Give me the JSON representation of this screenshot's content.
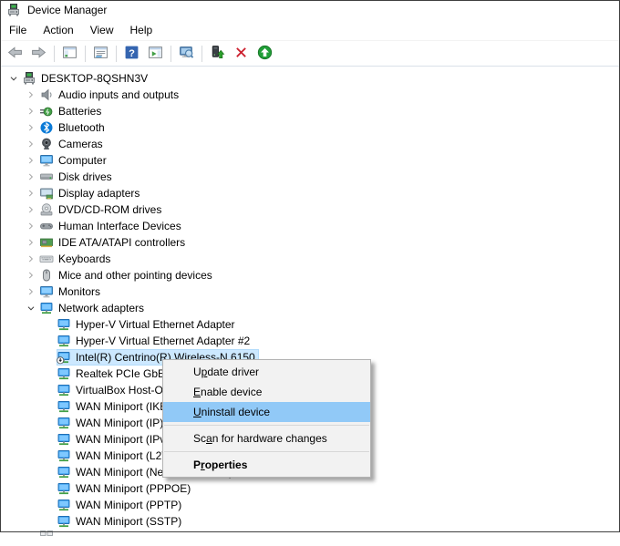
{
  "window": {
    "title": "Device Manager",
    "app_icon": "device-manager-icon"
  },
  "menu_bar": {
    "items": [
      {
        "label": "File"
      },
      {
        "label": "Action"
      },
      {
        "label": "View"
      },
      {
        "label": "Help"
      }
    ]
  },
  "toolbar": {
    "buttons": [
      {
        "name": "back-button",
        "icon": "back-icon"
      },
      {
        "name": "forward-button",
        "icon": "forward-icon"
      },
      {
        "separator": true
      },
      {
        "name": "console-tree-button",
        "icon": "console-tree-icon"
      },
      {
        "separator": true
      },
      {
        "name": "properties-button",
        "icon": "properties-icon"
      },
      {
        "separator": true
      },
      {
        "name": "help-button",
        "icon": "help-icon"
      },
      {
        "name": "action-pane-button",
        "icon": "action-pane-icon"
      },
      {
        "separator": true
      },
      {
        "name": "scan-hardware-button",
        "icon": "scan-hardware-icon"
      },
      {
        "separator": true
      },
      {
        "name": "enable-device-button",
        "icon": "enable-device-icon"
      },
      {
        "name": "uninstall-device-button",
        "icon": "uninstall-device-icon"
      },
      {
        "name": "update-driver-button",
        "icon": "update-driver-icon"
      }
    ]
  },
  "tree": {
    "items": [
      {
        "level": 0,
        "chevron": "expanded",
        "icon": "computer-host-icon",
        "label": "DESKTOP-8QSHN3V"
      },
      {
        "level": 1,
        "chevron": "collapsed",
        "icon": "audio-icon",
        "label": "Audio inputs and outputs"
      },
      {
        "level": 1,
        "chevron": "collapsed",
        "icon": "battery-icon",
        "label": "Batteries"
      },
      {
        "level": 1,
        "chevron": "collapsed",
        "icon": "bluetooth-icon",
        "label": "Bluetooth"
      },
      {
        "level": 1,
        "chevron": "collapsed",
        "icon": "camera-icon",
        "label": "Cameras"
      },
      {
        "level": 1,
        "chevron": "collapsed",
        "icon": "monitor-icon",
        "label": "Computer"
      },
      {
        "level": 1,
        "chevron": "collapsed",
        "icon": "disk-icon",
        "label": "Disk drives"
      },
      {
        "level": 1,
        "chevron": "collapsed",
        "icon": "display-icon",
        "label": "Display adapters"
      },
      {
        "level": 1,
        "chevron": "collapsed",
        "icon": "dvd-icon",
        "label": "DVD/CD-ROM drives"
      },
      {
        "level": 1,
        "chevron": "collapsed",
        "icon": "hid-icon",
        "label": "Human Interface Devices"
      },
      {
        "level": 1,
        "chevron": "collapsed",
        "icon": "ide-icon",
        "label": "IDE ATA/ATAPI controllers"
      },
      {
        "level": 1,
        "chevron": "collapsed",
        "icon": "keyboard-icon",
        "label": "Keyboards"
      },
      {
        "level": 1,
        "chevron": "collapsed",
        "icon": "mouse-icon",
        "label": "Mice and other pointing devices"
      },
      {
        "level": 1,
        "chevron": "collapsed",
        "icon": "monitor-icon",
        "label": "Monitors"
      },
      {
        "level": 1,
        "chevron": "expanded",
        "icon": "network-icon",
        "label": "Network adapters"
      },
      {
        "level": 2,
        "chevron": "none",
        "icon": "network-icon",
        "label": "Hyper-V Virtual Ethernet Adapter"
      },
      {
        "level": 2,
        "chevron": "none",
        "icon": "network-icon",
        "label": "Hyper-V Virtual Ethernet Adapter #2"
      },
      {
        "level": 2,
        "chevron": "none",
        "icon": "network-disabled-icon",
        "label": "Intel(R) Centrino(R) Wireless-N 6150",
        "selected": true
      },
      {
        "level": 2,
        "chevron": "none",
        "icon": "network-icon",
        "label": "Realtek PCIe GbE Family Controller"
      },
      {
        "level": 2,
        "chevron": "none",
        "icon": "network-icon",
        "label": "VirtualBox Host-Only Ethernet Adapter"
      },
      {
        "level": 2,
        "chevron": "none",
        "icon": "network-icon",
        "label": "WAN Miniport (IKEv2)"
      },
      {
        "level": 2,
        "chevron": "none",
        "icon": "network-icon",
        "label": "WAN Miniport (IP)"
      },
      {
        "level": 2,
        "chevron": "none",
        "icon": "network-icon",
        "label": "WAN Miniport (IPv6)"
      },
      {
        "level": 2,
        "chevron": "none",
        "icon": "network-icon",
        "label": "WAN Miniport (L2TP)"
      },
      {
        "level": 2,
        "chevron": "none",
        "icon": "network-icon",
        "label": "WAN Miniport (Network Monitor)"
      },
      {
        "level": 2,
        "chevron": "none",
        "icon": "network-icon",
        "label": "WAN Miniport (PPPOE)"
      },
      {
        "level": 2,
        "chevron": "none",
        "icon": "network-icon",
        "label": "WAN Miniport (PPTP)"
      },
      {
        "level": 2,
        "chevron": "none",
        "icon": "network-icon",
        "label": "WAN Miniport (SSTP)"
      },
      {
        "level": 1,
        "chevron": "none",
        "icon": "partial-icon",
        "label": ""
      }
    ]
  },
  "context_menu": {
    "items": [
      {
        "label": "Update driver",
        "accel_index": 1
      },
      {
        "label": "Enable device",
        "accel_index": 0
      },
      {
        "label": "Uninstall device",
        "accel_index": 0,
        "highlighted": true
      },
      {
        "separator": true
      },
      {
        "label": "Scan for hardware changes",
        "accel_index": 2
      },
      {
        "separator": true
      },
      {
        "label": "Properties",
        "accel_index": 1,
        "bold": true
      }
    ]
  },
  "colors": {
    "tree_selection": "#cce8ff",
    "menu_highlight": "#91c9f7",
    "menu_background": "#f2f2f2",
    "uninstall_x_red": "#cc1f2d",
    "update_green": "#219e38",
    "bluetooth_blue": "#0a7ad7",
    "adapter_blue": "#3fa3ef"
  }
}
